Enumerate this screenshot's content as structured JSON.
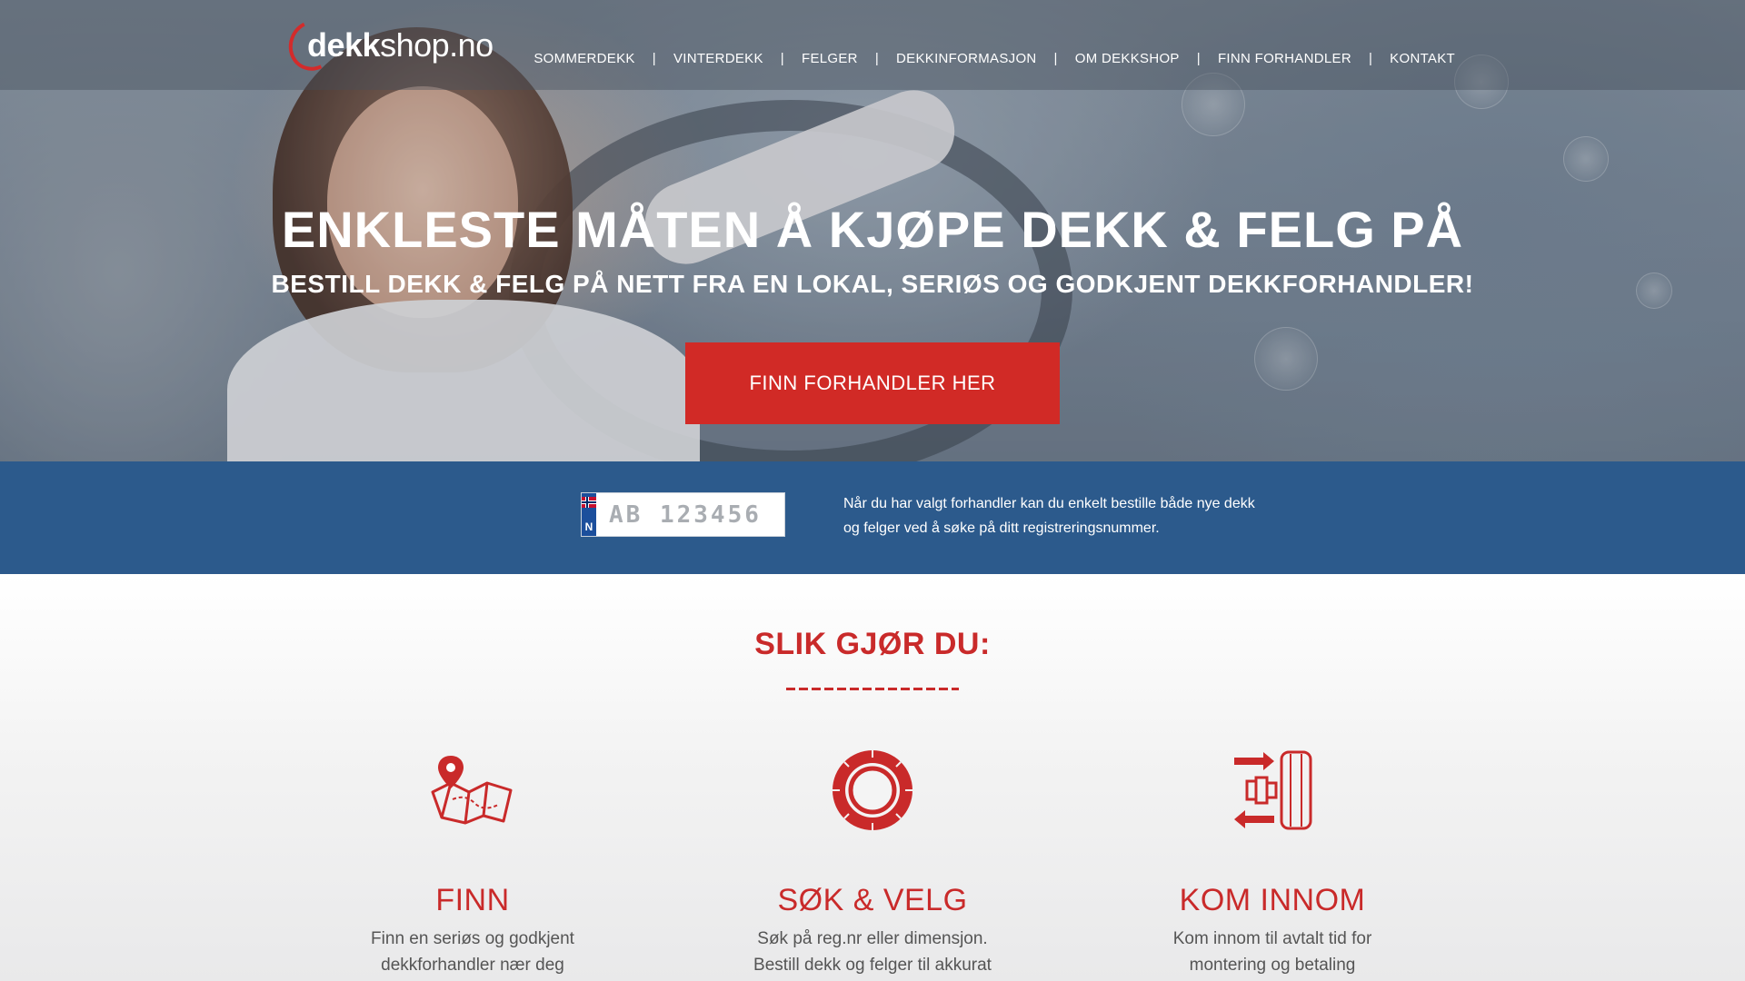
{
  "logo": {
    "bold": "dekk",
    "regular": "shop.no"
  },
  "nav": {
    "items": [
      "SOMMERDEKK",
      "VINTERDEKK",
      "FELGER",
      "DEKKINFORMASJON",
      "OM DEKKSHOP",
      "FINN FORHANDLER",
      "KONTAKT"
    ],
    "separator": "|"
  },
  "hero": {
    "title": "ENKLESTE MÅTEN Å KJØPE DEKK & FELG PÅ",
    "subtitle": "BESTILL DEKK & FELG PÅ NETT FRA EN LOKAL, SERIØS OG GODKJENT DEKKFORHANDLER!",
    "cta": "FINN FORHANDLER HER"
  },
  "reg": {
    "country": "N",
    "placeholder": "AB 123456",
    "text": "Når du har valgt forhandler kan du enkelt bestille både nye dekk og felger ved å søke på ditt registreringsnummer."
  },
  "steps": {
    "title": "SLIK GJØR DU:",
    "items": [
      {
        "icon": "map-pin-icon",
        "title": "FINN",
        "text": "Finn en seriøs og godkjent dekkforhandler nær deg"
      },
      {
        "icon": "tire-icon",
        "title": "SØK & VELG",
        "text": "Søk på reg.nr eller dimensjon. Bestill dekk og felger til akkurat din bil"
      },
      {
        "icon": "wheel-mount-icon",
        "title": "KOM INNOM",
        "text": "Kom innom til avtalt tid for montering og betaling"
      }
    ]
  },
  "colors": {
    "brand_red": "#d12a26",
    "band_blue": "#2c5a8c",
    "heading_red": "#c92a2a"
  }
}
